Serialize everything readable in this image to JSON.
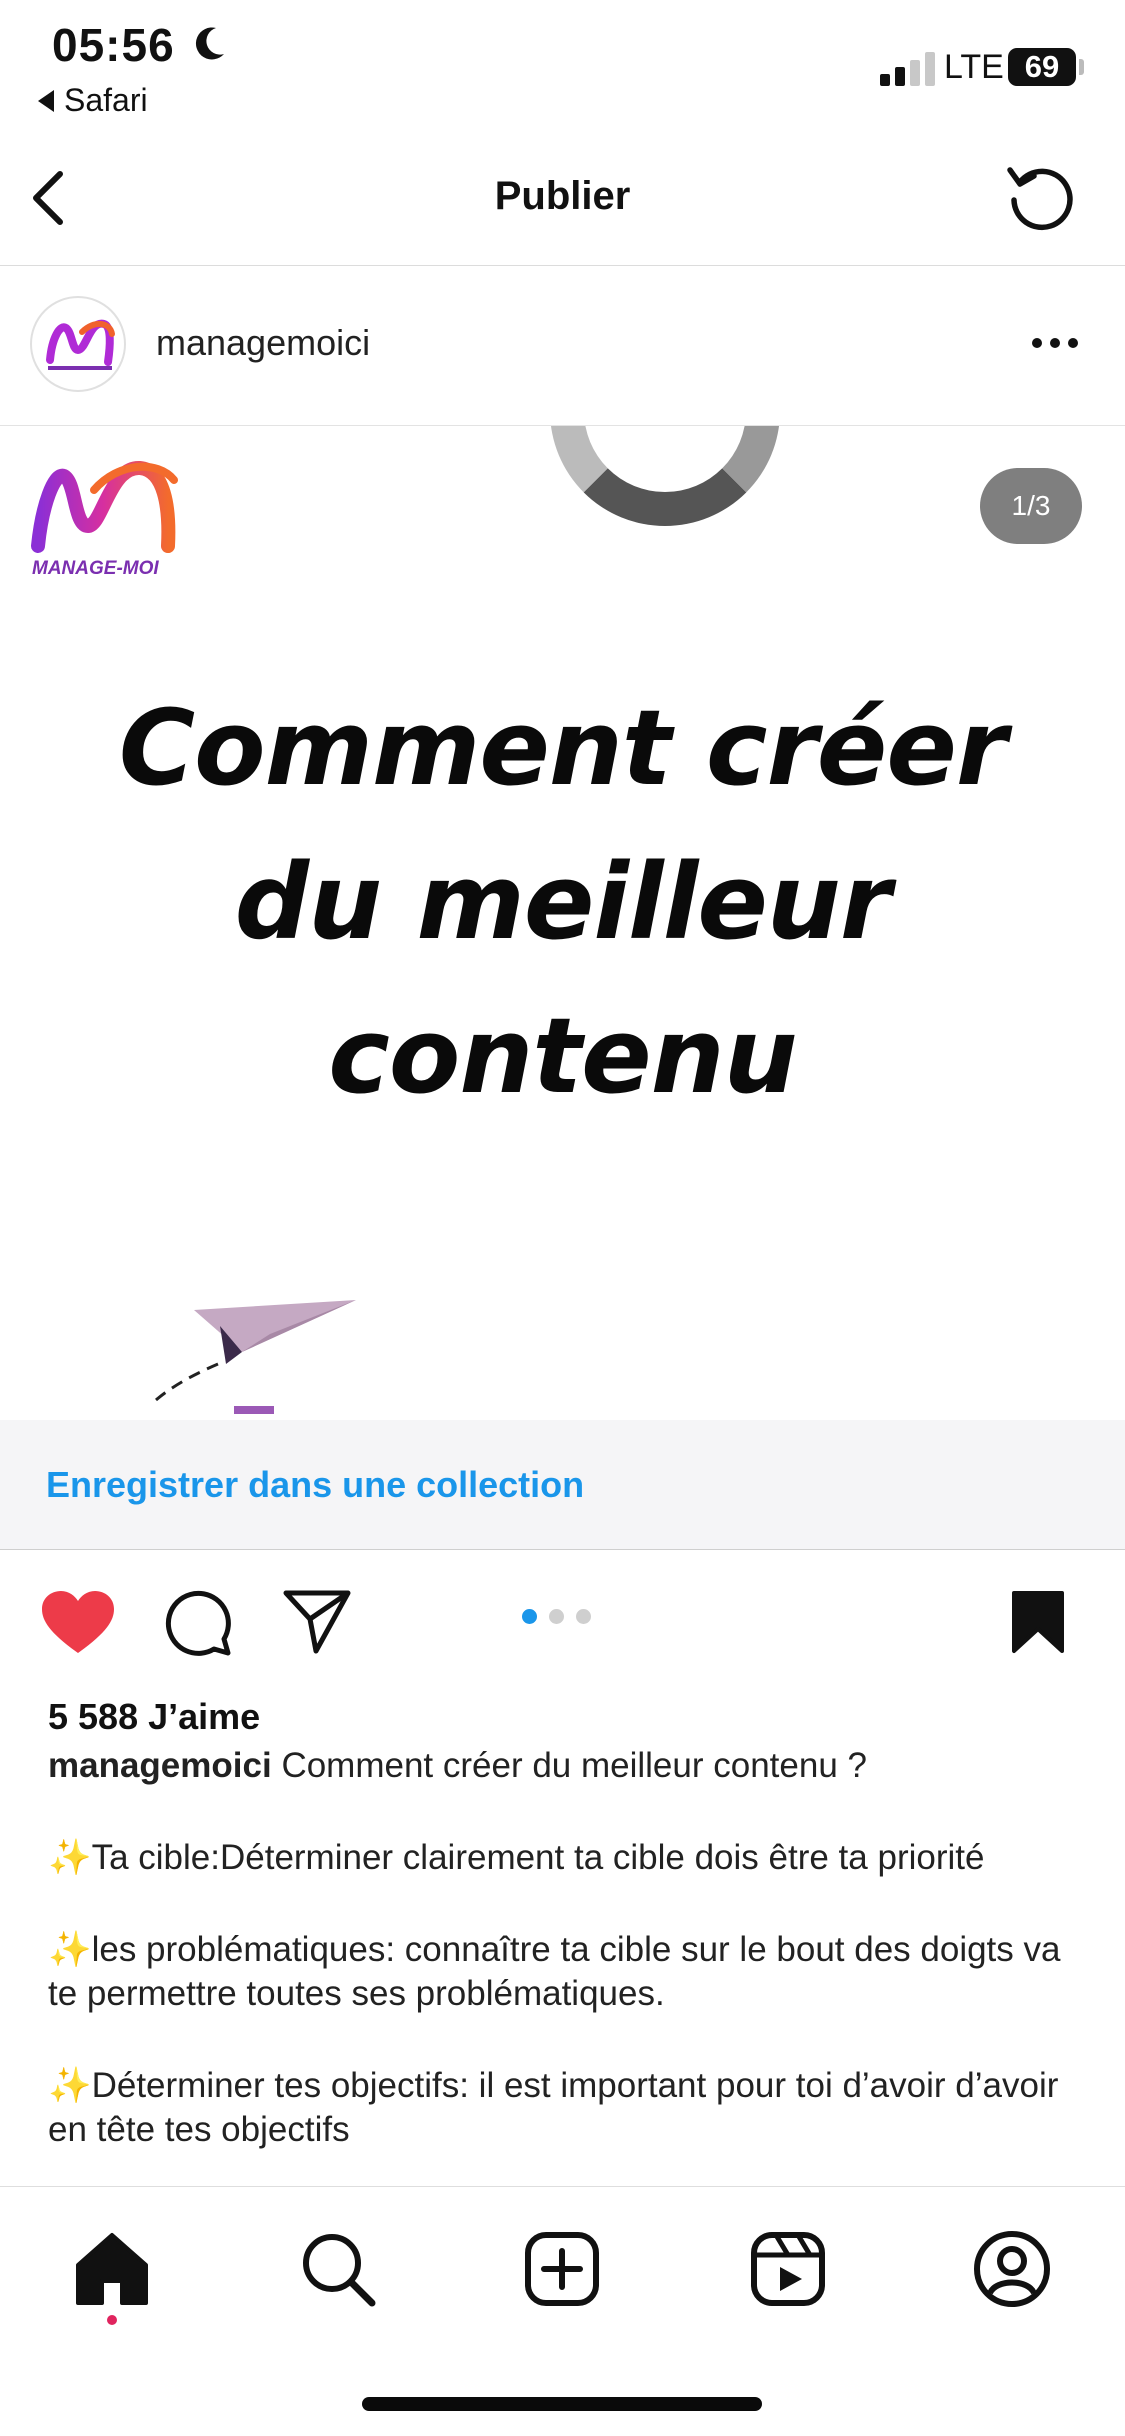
{
  "status_bar": {
    "time": "05:56",
    "back_app": "Safari",
    "network": "LTE",
    "battery": "69"
  },
  "nav": {
    "title": "Publier"
  },
  "post": {
    "username": "managemoici",
    "logo_text": "MANAGE-MOI",
    "image_counter": "1/3",
    "headline": [
      "Comment créer",
      "du meilleur",
      "contenu"
    ],
    "current_slide": 1,
    "total_slides": 3
  },
  "collection": {
    "label": "Enregistrer dans une collection"
  },
  "actions": {
    "liked": true,
    "saved": true
  },
  "caption": {
    "likes": "5 588 J’aime",
    "username": "managemoici",
    "title": "Comment créer du meilleur contenu ?",
    "paragraphs": [
      "✨Ta cible:Déterminer clairement ta cible dois être ta priorité",
      "✨les problématiques: connaître ta cible sur le bout des doigts va te permettre toutes ses problématiques.",
      "✨Déterminer tes objectifs: il est important pour toi d’avoir d’avoir en tête tes objectifs"
    ]
  },
  "tabbar": {
    "items": [
      "home-icon",
      "search-icon",
      "new-post-icon",
      "reels-icon",
      "profile-icon"
    ],
    "active": "home-icon"
  },
  "colors": {
    "accent_blue": "#1a96ea",
    "like_red": "#ed3b49",
    "notification_dot": "#e0245e"
  }
}
